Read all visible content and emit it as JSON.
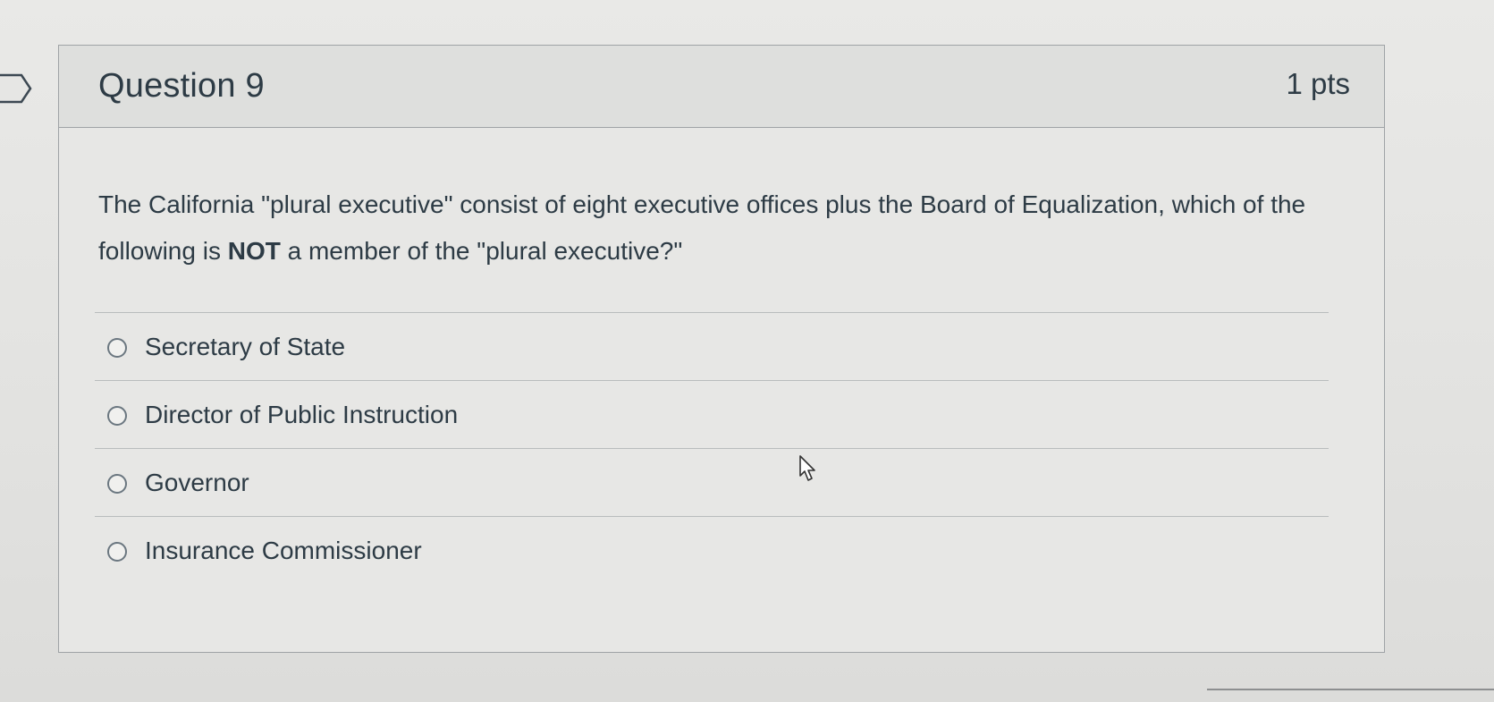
{
  "question": {
    "title": "Question 9",
    "points": "1 pts",
    "text_before_bold": "The California \"plural executive\" consist of eight executive offices plus the Board of Equalization, which of the following is ",
    "text_bold": "NOT",
    "text_after_bold": " a member of the \"plural executive?\""
  },
  "answers": [
    {
      "label": "Secretary of State",
      "selected": false
    },
    {
      "label": "Director of Public Instruction",
      "selected": false
    },
    {
      "label": "Governor",
      "selected": false
    },
    {
      "label": "Insurance Commissioner",
      "selected": false
    }
  ],
  "colors": {
    "text": "#2d3b45",
    "border": "#9fa3a6",
    "header_bg": "#dedfdd"
  },
  "icons": {
    "flag": "bookmark-flag-icon",
    "cursor": "mouse-pointer-icon"
  }
}
